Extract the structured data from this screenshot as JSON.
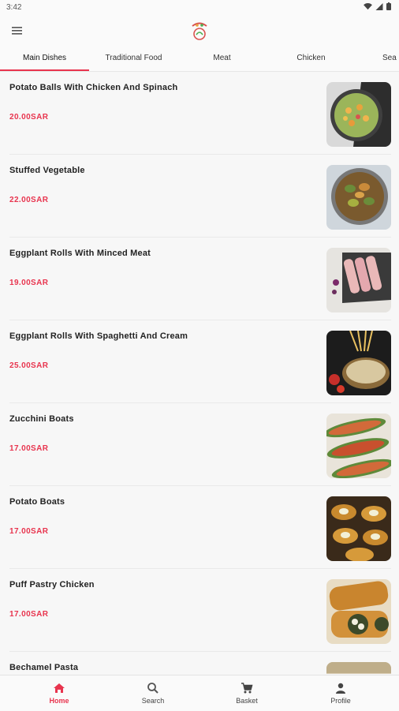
{
  "status_bar": {
    "time": "3:42"
  },
  "tabs": [
    {
      "label": "Main Dishes",
      "active": true
    },
    {
      "label": "Traditional Food",
      "active": false
    },
    {
      "label": "Meat",
      "active": false
    },
    {
      "label": "Chicken",
      "active": false
    },
    {
      "label": "Sea F",
      "active": false
    }
  ],
  "items": [
    {
      "name": "Potato Balls With Chicken And Spinach",
      "price": "20.00SAR"
    },
    {
      "name": "Stuffed Vegetable",
      "price": "22.00SAR"
    },
    {
      "name": "Eggplant Rolls With Minced Meat",
      "price": "19.00SAR"
    },
    {
      "name": "Eggplant Rolls With Spaghetti And Cream",
      "price": "25.00SAR"
    },
    {
      "name": "Zucchini Boats",
      "price": "17.00SAR"
    },
    {
      "name": "Potato Boats",
      "price": "17.00SAR"
    },
    {
      "name": "Puff Pastry Chicken",
      "price": "17.00SAR"
    },
    {
      "name": "Bechamel Pasta",
      "price": ""
    }
  ],
  "bottom_nav": [
    {
      "label": "Home",
      "icon": "home-icon",
      "active": true
    },
    {
      "label": "Search",
      "icon": "search-icon",
      "active": false
    },
    {
      "label": "Basket",
      "icon": "cart-icon",
      "active": false
    },
    {
      "label": "Profile",
      "icon": "profile-icon",
      "active": false
    }
  ],
  "colors": {
    "accent": "#e8344e",
    "background": "#f7f7f7"
  }
}
